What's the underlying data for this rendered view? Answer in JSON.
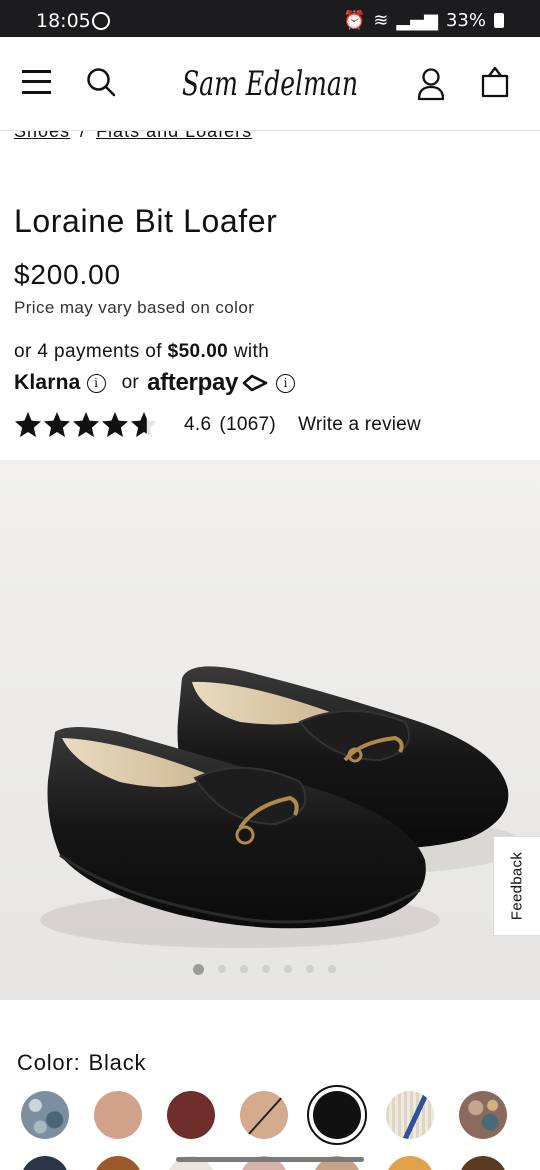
{
  "status_bar": {
    "time": "18:05",
    "battery": "33%"
  },
  "header": {
    "brand": "Sam Edelman",
    "icons": [
      "menu-icon",
      "search-icon",
      "account-icon",
      "bag-icon"
    ]
  },
  "breadcrumb": {
    "items": [
      "Shoes",
      "Flats and Loafers"
    ],
    "separator": "/"
  },
  "product": {
    "title": "Loraine Bit Loafer",
    "price": "$200.00",
    "price_note": "Price may vary based on color",
    "installments_prefix": "or 4 payments of",
    "installment_amount": "$50.00",
    "installments_suffix": "with",
    "klarna": "Klarna",
    "or": "or",
    "afterpay": "afterpay",
    "rating": "4.6",
    "rating_value": 4.6,
    "review_count": "(1067)",
    "write_review": "Write a review"
  },
  "gallery": {
    "image_count": 7,
    "active_index": 0
  },
  "feedback_tab": "Feedback",
  "color": {
    "label": "Color:",
    "selected": "Black",
    "swatch_colors": [
      "#7c8fa0",
      "#d2a189",
      "#6e2e2a",
      "#d5ab8e",
      "#111111",
      "#e7e2d6",
      "#8a6a5c"
    ]
  },
  "colors": {
    "accent": "#111111",
    "status_bar": "#1c1c1e"
  }
}
